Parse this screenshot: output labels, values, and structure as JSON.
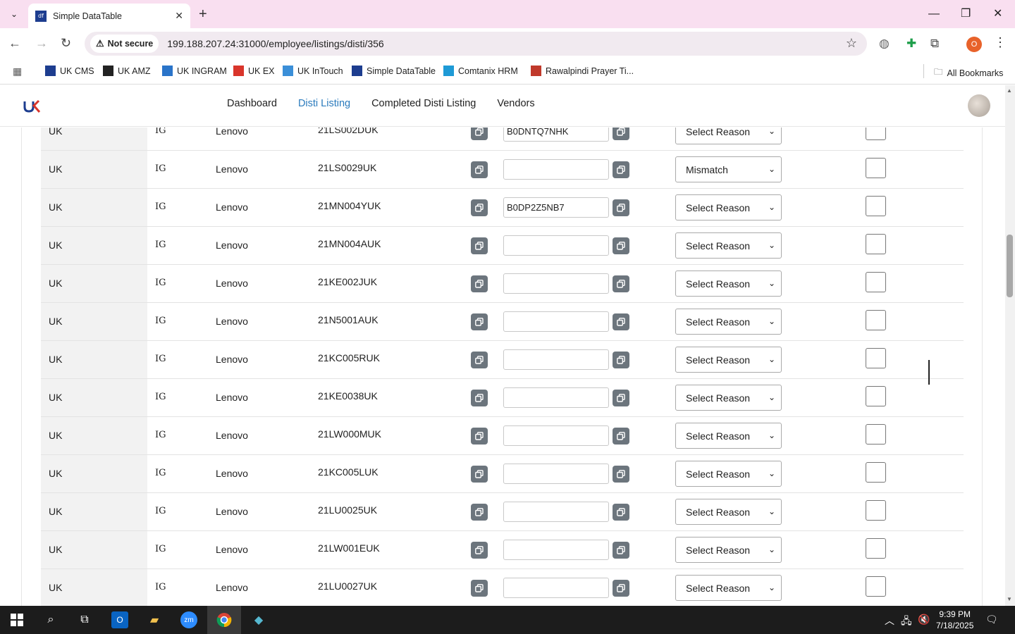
{
  "browser": {
    "tab_title": "Simple DataTable",
    "tab_favicon": "df",
    "security_label": "Not secure",
    "url": "199.188.207.24:31000/employee/listings/disti/356",
    "profile_initial": "O",
    "bookmarks": [
      {
        "label": "UK CMS",
        "color": "#1d3d8f"
      },
      {
        "label": "UK AMZ",
        "color": "#222222"
      },
      {
        "label": "UK INGRAM",
        "color": "#2a74c9"
      },
      {
        "label": "UK EX",
        "color": "#d9352b"
      },
      {
        "label": "UK InTouch",
        "color": "#3b8fd8"
      },
      {
        "label": "Simple DataTable",
        "color": "#1d3d8f"
      },
      {
        "label": "Comtanix HRM",
        "color": "#1e9ad6"
      },
      {
        "label": "Rawalpindi Prayer Ti...",
        "color": "#c0392b"
      }
    ],
    "all_bookmarks": "All Bookmarks"
  },
  "nav": {
    "links": [
      "Dashboard",
      "Disti Listing",
      "Completed Disti Listing",
      "Vendors"
    ],
    "active": "Disti Listing"
  },
  "rows": [
    {
      "country": "UK",
      "disti": "IG",
      "brand": "Lenovo",
      "sku": "21LS002DUK",
      "asin": "B0DNTQ7NHK",
      "reason": "Select Reason"
    },
    {
      "country": "UK",
      "disti": "IG",
      "brand": "Lenovo",
      "sku": "21LS0029UK",
      "asin": "",
      "reason": "Mismatch"
    },
    {
      "country": "UK",
      "disti": "IG",
      "brand": "Lenovo",
      "sku": "21MN004YUK",
      "asin": "B0DP2Z5NB7",
      "reason": "Select Reason"
    },
    {
      "country": "UK",
      "disti": "IG",
      "brand": "Lenovo",
      "sku": "21MN004AUK",
      "asin": "",
      "reason": "Select Reason"
    },
    {
      "country": "UK",
      "disti": "IG",
      "brand": "Lenovo",
      "sku": "21KE002JUK",
      "asin": "",
      "reason": "Select Reason"
    },
    {
      "country": "UK",
      "disti": "IG",
      "brand": "Lenovo",
      "sku": "21N5001AUK",
      "asin": "",
      "reason": "Select Reason"
    },
    {
      "country": "UK",
      "disti": "IG",
      "brand": "Lenovo",
      "sku": "21KC005RUK",
      "asin": "",
      "reason": "Select Reason"
    },
    {
      "country": "UK",
      "disti": "IG",
      "brand": "Lenovo",
      "sku": "21KE0038UK",
      "asin": "",
      "reason": "Select Reason"
    },
    {
      "country": "UK",
      "disti": "IG",
      "brand": "Lenovo",
      "sku": "21LW000MUK",
      "asin": "",
      "reason": "Select Reason"
    },
    {
      "country": "UK",
      "disti": "IG",
      "brand": "Lenovo",
      "sku": "21KC005LUK",
      "asin": "",
      "reason": "Select Reason"
    },
    {
      "country": "UK",
      "disti": "IG",
      "brand": "Lenovo",
      "sku": "21LU0025UK",
      "asin": "",
      "reason": "Select Reason"
    },
    {
      "country": "UK",
      "disti": "IG",
      "brand": "Lenovo",
      "sku": "21LW001EUK",
      "asin": "",
      "reason": "Select Reason"
    },
    {
      "country": "UK",
      "disti": "IG",
      "brand": "Lenovo",
      "sku": "21LU0027UK",
      "asin": "",
      "reason": "Select Reason"
    }
  ],
  "taskbar": {
    "time": "9:39 PM",
    "date": "7/18/2025"
  },
  "colors": {
    "tabbar": "#f9dff0",
    "active_link": "#2b7bbd",
    "copy_button": "#6c757d"
  }
}
